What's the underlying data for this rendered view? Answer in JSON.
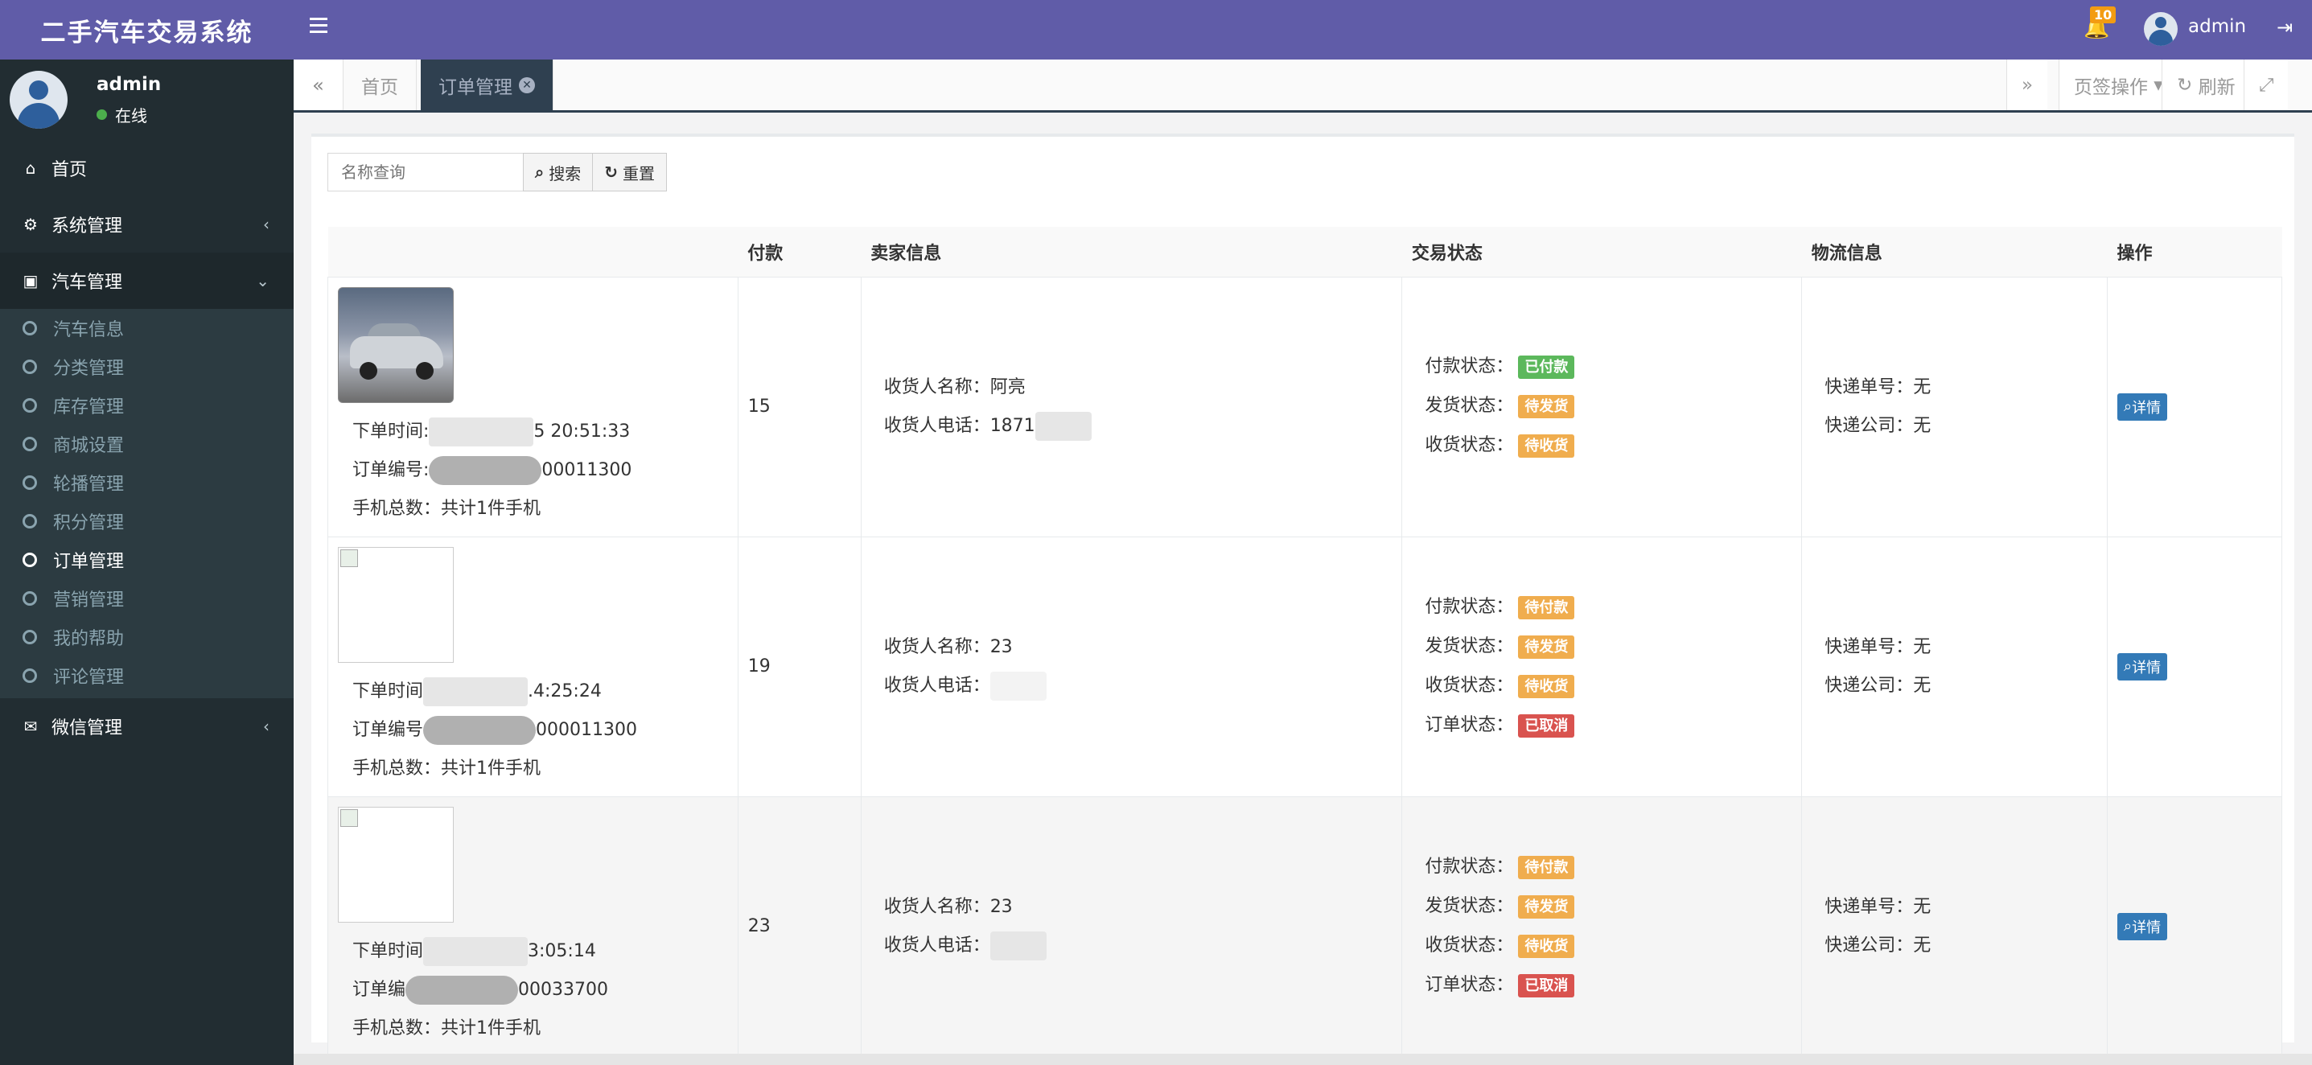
{
  "app": {
    "title": "二手汽车交易系统"
  },
  "header": {
    "notifications_count": "10",
    "username": "admin"
  },
  "user_panel": {
    "name": "admin",
    "status": "在线"
  },
  "sidebar": {
    "items": [
      {
        "label": "首页",
        "icon": "home-icon"
      },
      {
        "label": "系统管理",
        "icon": "cogs-icon"
      },
      {
        "label": "汽车管理",
        "icon": "shopping-bag-icon",
        "expanded": true
      },
      {
        "label": "微信管理",
        "icon": "wechat-icon"
      }
    ],
    "submenu": [
      "汽车信息",
      "分类管理",
      "库存管理",
      "商城设置",
      "轮播管理",
      "积分管理",
      "订单管理",
      "营销管理",
      "我的帮助",
      "评论管理"
    ]
  },
  "tabs": {
    "items": [
      {
        "label": "首页"
      },
      {
        "label": "订单管理"
      }
    ],
    "page_actions": "页签操作",
    "refresh": "刷新"
  },
  "search": {
    "placeholder": "名称查询",
    "search_label": "搜索",
    "reset_label": "重置"
  },
  "table": {
    "headers": [
      "",
      "付款",
      "卖家信息",
      "交易状态",
      "物流信息",
      "操作"
    ],
    "rows": [
      {
        "order_time_label": "下单时间:",
        "order_time_suffix": "5 20:51:33",
        "order_no_label": "订单编号:",
        "order_no_suffix": "00011300",
        "total": "手机总数：共计1件手机",
        "payment": "15",
        "receiver_name": "收货人名称：阿亮",
        "receiver_phone": "收货人电话：1871",
        "status": [
          {
            "label": "付款状态：",
            "badge": "已付款",
            "color": "green"
          },
          {
            "label": "发货状态：",
            "badge": "待发货",
            "color": "orange"
          },
          {
            "label": "收货状态：",
            "badge": "待收货",
            "color": "orange"
          }
        ],
        "tracking": "快递单号：无",
        "courier": "快递公司：无",
        "action": "详情"
      },
      {
        "order_time_label": "下单时间",
        "order_time_suffix": ".4:25:24",
        "order_no_label": "订单编号",
        "order_no_suffix": "000011300",
        "total": "手机总数：共计1件手机",
        "payment": "19",
        "receiver_name": "收货人名称：23",
        "receiver_phone": "收货人电话：",
        "status": [
          {
            "label": "付款状态：",
            "badge": "待付款",
            "color": "orange"
          },
          {
            "label": "发货状态：",
            "badge": "待发货",
            "color": "orange"
          },
          {
            "label": "收货状态：",
            "badge": "待收货",
            "color": "orange"
          },
          {
            "label": "订单状态：",
            "badge": "已取消",
            "color": "red"
          }
        ],
        "tracking": "快递单号：无",
        "courier": "快递公司：无",
        "action": "详情"
      },
      {
        "order_time_label": "下单时间",
        "order_time_suffix": "3:05:14",
        "order_no_label": "订单编",
        "order_no_suffix": "00033700",
        "total": "手机总数：共计1件手机",
        "payment": "23",
        "receiver_name": "收货人名称：23",
        "receiver_phone": "收货人电话：",
        "status": [
          {
            "label": "付款状态：",
            "badge": "待付款",
            "color": "orange"
          },
          {
            "label": "发货状态：",
            "badge": "待发货",
            "color": "orange"
          },
          {
            "label": "收货状态：",
            "badge": "待收货",
            "color": "orange"
          },
          {
            "label": "订单状态：",
            "badge": "已取消",
            "color": "red"
          }
        ],
        "tracking": "快递单号：无",
        "courier": "快递公司：无",
        "action": "详情"
      }
    ]
  }
}
